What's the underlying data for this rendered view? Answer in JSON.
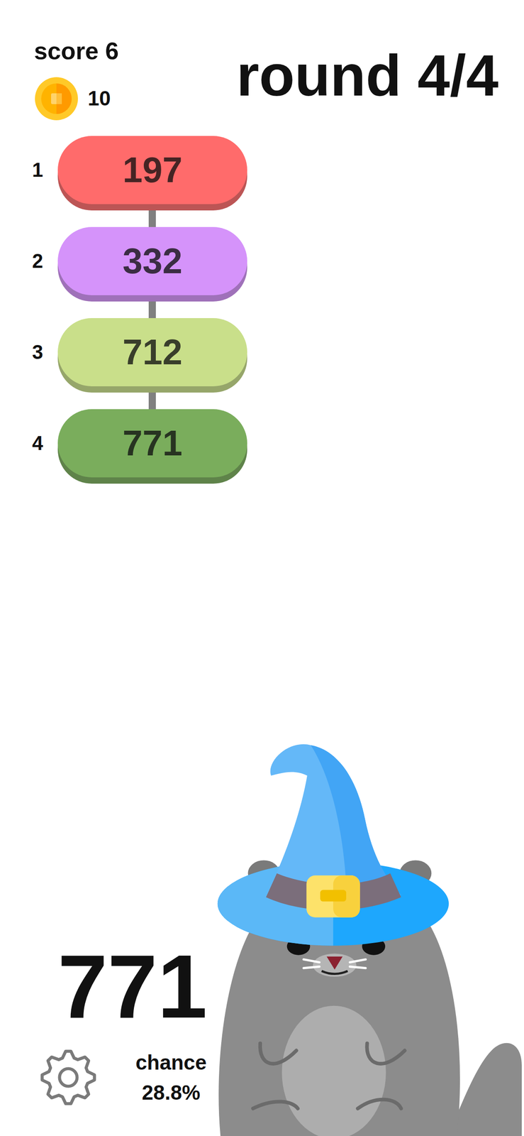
{
  "score": "score 6",
  "coins": "10",
  "round": "round 4/4",
  "ladder": [
    {
      "index": "1",
      "value": "197",
      "color": "#ff6b6b"
    },
    {
      "index": "2",
      "value": "332",
      "color": "#d593fa"
    },
    {
      "index": "3",
      "value": "712",
      "color": "#c9df8a"
    },
    {
      "index": "4",
      "value": "771",
      "color": "#7aad5c"
    }
  ],
  "current": "771",
  "chance": {
    "label": "chance",
    "value": "28.8%"
  }
}
